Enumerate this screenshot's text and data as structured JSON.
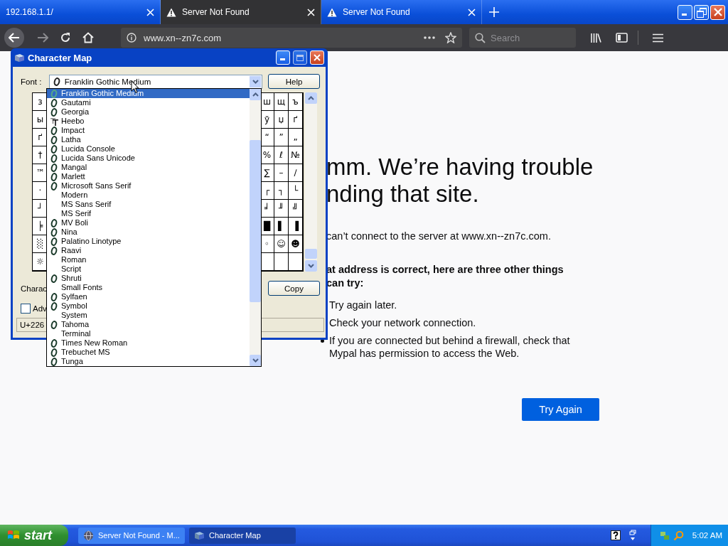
{
  "browser": {
    "tabs": [
      {
        "title": "192.168.1.1/",
        "selected": false,
        "warning": false
      },
      {
        "title": "Server Not Found",
        "selected": true,
        "warning": true
      },
      {
        "title": "Server Not Found",
        "selected": false,
        "warning": true
      }
    ],
    "url": "www.xn--zn7c.com",
    "search": {
      "placeholder": "Search"
    }
  },
  "error_page": {
    "heading_lines": [
      "mm. We’re having trouble",
      "nding that site."
    ],
    "message": "can’t connect to the server at www.xn--zn7c.com.",
    "suggestions_heading_lines": [
      "at address is correct, here are three other things",
      "can try:"
    ],
    "suggestions": [
      "Try again later.",
      "Check your network connection.",
      "If you are connected but behind a firewall, check that Mypal has permission to access the Web."
    ],
    "button": "Try Again"
  },
  "character_map": {
    "title": "Character Map",
    "font_label": "Font :",
    "font_value": "Franklin Gothic Medium",
    "help_button": "Help",
    "grid_left": [
      "з",
      "ы",
      "ґ",
      "†",
      "™",
      "·",
      "┘",
      "╞",
      "░",
      "☼"
    ],
    "grid_right": [
      [
        "ш",
        "щ",
        "ъ"
      ],
      [
        "ў",
        "џ",
        "ґ"
      ],
      [
        "“",
        "”",
        "„"
      ],
      [
        "%",
        "ℓ",
        "№"
      ],
      [
        "∑",
        "–",
        "∕"
      ],
      [
        "┌",
        "┐",
        "└"
      ],
      [
        "╛",
        "╜",
        "╝"
      ],
      [
        "█",
        "▌",
        "▐"
      ],
      [
        "◦",
        "☺",
        "☻"
      ]
    ],
    "characters_label": "Charac",
    "copy_button": "Copy",
    "advanced": {
      "label": "Adv",
      "checked": false
    },
    "status": "U+226",
    "font_list": [
      {
        "name": "Franklin Gothic Medium",
        "kind": "opentype",
        "selected": true
      },
      {
        "name": "Gautami",
        "kind": "opentype",
        "selected": false
      },
      {
        "name": "Georgia",
        "kind": "opentype",
        "selected": false
      },
      {
        "name": "Heebo",
        "kind": "truetype",
        "selected": false
      },
      {
        "name": "Impact",
        "kind": "opentype",
        "selected": false
      },
      {
        "name": "Latha",
        "kind": "opentype",
        "selected": false
      },
      {
        "name": "Lucida Console",
        "kind": "opentype",
        "selected": false
      },
      {
        "name": "Lucida Sans Unicode",
        "kind": "opentype",
        "selected": false
      },
      {
        "name": "Mangal",
        "kind": "opentype",
        "selected": false
      },
      {
        "name": "Marlett",
        "kind": "opentype",
        "selected": false
      },
      {
        "name": "Microsoft Sans Serif",
        "kind": "opentype",
        "selected": false
      },
      {
        "name": "Modern",
        "kind": "bitmap",
        "selected": false
      },
      {
        "name": "MS Sans Serif",
        "kind": "bitmap",
        "selected": false
      },
      {
        "name": "MS Serif",
        "kind": "bitmap",
        "selected": false
      },
      {
        "name": "MV Boli",
        "kind": "opentype",
        "selected": false
      },
      {
        "name": "Nina",
        "kind": "opentype",
        "selected": false
      },
      {
        "name": "Palatino Linotype",
        "kind": "opentype",
        "selected": false
      },
      {
        "name": "Raavi",
        "kind": "opentype",
        "selected": false
      },
      {
        "name": "Roman",
        "kind": "bitmap",
        "selected": false
      },
      {
        "name": "Script",
        "kind": "bitmap",
        "selected": false
      },
      {
        "name": "Shruti",
        "kind": "opentype",
        "selected": false
      },
      {
        "name": "Small Fonts",
        "kind": "bitmap",
        "selected": false
      },
      {
        "name": "Sylfaen",
        "kind": "opentype",
        "selected": false
      },
      {
        "name": "Symbol",
        "kind": "opentype",
        "selected": false
      },
      {
        "name": "System",
        "kind": "bitmap",
        "selected": false
      },
      {
        "name": "Tahoma",
        "kind": "opentype",
        "selected": false
      },
      {
        "name": "Terminal",
        "kind": "bitmap",
        "selected": false
      },
      {
        "name": "Times New Roman",
        "kind": "opentype",
        "selected": false
      },
      {
        "name": "Trebuchet MS",
        "kind": "opentype",
        "selected": false
      },
      {
        "name": "Tunga",
        "kind": "opentype",
        "selected": false
      }
    ]
  },
  "taskbar": {
    "start": "start",
    "tasks": [
      {
        "label": "Server Not Found - M...",
        "kind": "browser",
        "selected": false
      },
      {
        "label": "Character Map",
        "kind": "charmap",
        "selected": true
      }
    ],
    "clock": "5:02 AM"
  }
}
